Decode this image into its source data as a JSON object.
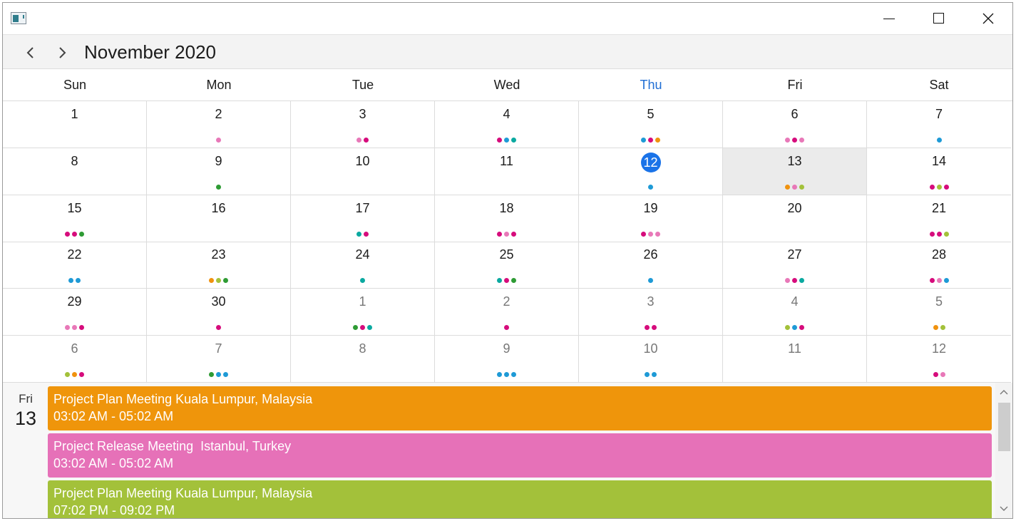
{
  "header": {
    "month_title": "November 2020"
  },
  "weekdays": [
    "Sun",
    "Mon",
    "Tue",
    "Wed",
    "Thu",
    "Fri",
    "Sat"
  ],
  "today_weekday_index": 4,
  "colors": {
    "pink": "#e878b8",
    "magenta": "#d60c7c",
    "blue": "#1e9ad6",
    "teal": "#0aa9a0",
    "orange": "#f0920e",
    "green": "#2e9b34",
    "lime": "#a3c13a",
    "today_circle": "#1a73e8"
  },
  "weeks": [
    [
      {
        "day": "1",
        "other": false,
        "dots": []
      },
      {
        "day": "2",
        "other": false,
        "dots": [
          "pink"
        ]
      },
      {
        "day": "3",
        "other": false,
        "dots": [
          "pink",
          "magenta"
        ]
      },
      {
        "day": "4",
        "other": false,
        "dots": [
          "magenta",
          "blue",
          "teal"
        ]
      },
      {
        "day": "5",
        "other": false,
        "dots": [
          "blue",
          "magenta",
          "orange"
        ]
      },
      {
        "day": "6",
        "other": false,
        "dots": [
          "pink",
          "magenta",
          "pink"
        ]
      },
      {
        "day": "7",
        "other": false,
        "dots": [
          "blue"
        ]
      }
    ],
    [
      {
        "day": "8",
        "other": false,
        "dots": []
      },
      {
        "day": "9",
        "other": false,
        "dots": [
          "green"
        ]
      },
      {
        "day": "10",
        "other": false,
        "dots": []
      },
      {
        "day": "11",
        "other": false,
        "dots": []
      },
      {
        "day": "12",
        "other": false,
        "today": true,
        "dots": [
          "blue"
        ]
      },
      {
        "day": "13",
        "other": false,
        "selected": true,
        "dots": [
          "orange",
          "pink",
          "lime"
        ]
      },
      {
        "day": "14",
        "other": false,
        "dots": [
          "magenta",
          "lime",
          "magenta"
        ]
      }
    ],
    [
      {
        "day": "15",
        "other": false,
        "dots": [
          "magenta",
          "magenta",
          "green"
        ]
      },
      {
        "day": "16",
        "other": false,
        "dots": []
      },
      {
        "day": "17",
        "other": false,
        "dots": [
          "teal",
          "magenta"
        ]
      },
      {
        "day": "18",
        "other": false,
        "dots": [
          "magenta",
          "pink",
          "magenta"
        ]
      },
      {
        "day": "19",
        "other": false,
        "dots": [
          "magenta",
          "pink",
          "pink"
        ]
      },
      {
        "day": "20",
        "other": false,
        "dots": []
      },
      {
        "day": "21",
        "other": false,
        "dots": [
          "magenta",
          "magenta",
          "lime"
        ]
      }
    ],
    [
      {
        "day": "22",
        "other": false,
        "dots": [
          "blue",
          "blue"
        ]
      },
      {
        "day": "23",
        "other": false,
        "dots": [
          "orange",
          "lime",
          "green"
        ]
      },
      {
        "day": "24",
        "other": false,
        "dots": [
          "teal"
        ]
      },
      {
        "day": "25",
        "other": false,
        "dots": [
          "teal",
          "magenta",
          "green"
        ]
      },
      {
        "day": "26",
        "other": false,
        "dots": [
          "blue"
        ]
      },
      {
        "day": "27",
        "other": false,
        "dots": [
          "pink",
          "magenta",
          "teal"
        ]
      },
      {
        "day": "28",
        "other": false,
        "dots": [
          "magenta",
          "pink",
          "blue"
        ]
      }
    ],
    [
      {
        "day": "29",
        "other": false,
        "dots": [
          "pink",
          "pink",
          "magenta"
        ]
      },
      {
        "day": "30",
        "other": false,
        "dots": [
          "magenta"
        ]
      },
      {
        "day": "1",
        "other": true,
        "dots": [
          "green",
          "magenta",
          "teal"
        ]
      },
      {
        "day": "2",
        "other": true,
        "dots": [
          "magenta"
        ]
      },
      {
        "day": "3",
        "other": true,
        "dots": [
          "magenta",
          "magenta"
        ]
      },
      {
        "day": "4",
        "other": true,
        "dots": [
          "lime",
          "blue",
          "magenta"
        ]
      },
      {
        "day": "5",
        "other": true,
        "dots": [
          "orange",
          "lime"
        ]
      }
    ],
    [
      {
        "day": "6",
        "other": true,
        "dots": [
          "lime",
          "orange",
          "magenta"
        ]
      },
      {
        "day": "7",
        "other": true,
        "dots": [
          "green",
          "blue",
          "blue"
        ]
      },
      {
        "day": "8",
        "other": true,
        "dots": []
      },
      {
        "day": "9",
        "other": true,
        "dots": [
          "blue",
          "blue",
          "blue"
        ]
      },
      {
        "day": "10",
        "other": true,
        "dots": [
          "blue",
          "blue"
        ]
      },
      {
        "day": "11",
        "other": true,
        "dots": []
      },
      {
        "day": "12",
        "other": true,
        "dots": [
          "magenta",
          "pink"
        ]
      }
    ]
  ],
  "agenda": {
    "weekday": "Fri",
    "date": "13",
    "events": [
      {
        "title": "Project Plan Meeting Kuala Lumpur, Malaysia",
        "time": "03:02 AM - 05:02 AM",
        "color": "#ef950b"
      },
      {
        "title": "Project Release Meeting  Istanbul, Turkey",
        "time": "03:02 AM - 05:02 AM",
        "color": "#e671b8"
      },
      {
        "title": "Project Plan Meeting Kuala Lumpur, Malaysia",
        "time": "07:02 PM - 09:02 PM",
        "color": "#a3c13a"
      }
    ]
  }
}
